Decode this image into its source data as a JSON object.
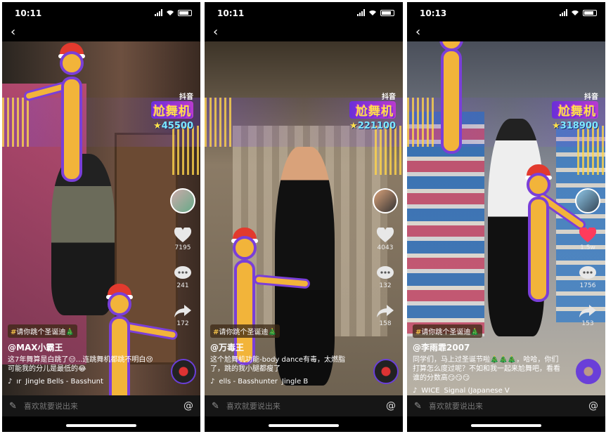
{
  "colors": {
    "accent_purple": "#7a3fd8",
    "figure_yellow": "#f2b43a",
    "score_cyan": "#7ee8ff",
    "like_red": "#ff3b5c"
  },
  "logo": {
    "small": "抖音",
    "main": "尬舞机"
  },
  "input": {
    "placeholder": "喜欢就要说出来",
    "at_label": "@"
  },
  "phones": [
    {
      "time": "10:11",
      "score": "45500",
      "likes": "7195",
      "comments": "241",
      "shares": "172",
      "tag": "请你跳个圣诞迪🎄",
      "author": "@MAX小霸王",
      "desc": "这7年舞算是白跳了😑...连跳舞机都跳不明白😢可能我的分儿是最低的😂",
      "music_a": "ır",
      "music_b": "Jingle Bells - Basshunt"
    },
    {
      "time": "10:11",
      "score": "221100",
      "likes": "4043",
      "comments": "132",
      "shares": "158",
      "tag": "请你跳个圣诞迪🎄",
      "author": "@万毒王",
      "desc": "这个尬舞机功能-body dance有毒，太燃脂了，跳的我小腿都瘦了",
      "music_a": "ells - Basshunter",
      "music_b": "Jingle B"
    },
    {
      "time": "10:13",
      "score": "318900",
      "likes": "1.5w",
      "comments": "1756",
      "shares": "153",
      "tag": "请你跳个圣诞迪🎄",
      "author": "@李雨霏2007",
      "desc": "同学们，马上过圣诞节啦🎄🎄🎄，哈哈，你们打算怎么度过呢？不如和我一起来尬舞吧，看看谁的分数高😏😏😏",
      "music_a": "WICE",
      "music_b": "Signal (Japanese V"
    }
  ]
}
